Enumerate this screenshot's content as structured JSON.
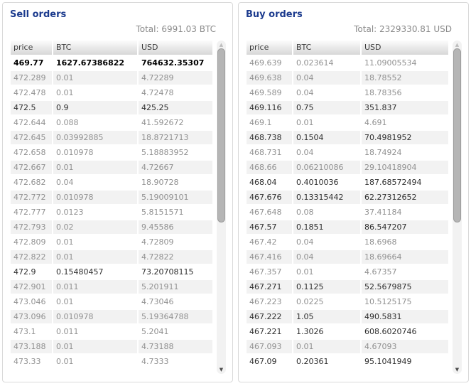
{
  "panels": [
    {
      "title": "Sell orders",
      "total": "Total: 6991.03 BTC",
      "columns": [
        "price",
        "BTC",
        "USD"
      ],
      "rows": [
        {
          "price": "469.77",
          "btc": "1627.67386822",
          "usd": "764632.35307",
          "style": "bold"
        },
        {
          "price": "472.289",
          "btc": "0.01",
          "usd": "4.72289",
          "style": "gray"
        },
        {
          "price": "472.478",
          "btc": "0.01",
          "usd": "4.72478",
          "style": "gray"
        },
        {
          "price": "472.5",
          "btc": "0.9",
          "usd": "425.25",
          "style": "dark"
        },
        {
          "price": "472.644",
          "btc": "0.088",
          "usd": "41.592672",
          "style": "gray"
        },
        {
          "price": "472.645",
          "btc": "0.03992885",
          "usd": "18.8721713",
          "style": "gray"
        },
        {
          "price": "472.658",
          "btc": "0.010978",
          "usd": "5.18883952",
          "style": "gray"
        },
        {
          "price": "472.667",
          "btc": "0.01",
          "usd": "4.72667",
          "style": "gray"
        },
        {
          "price": "472.682",
          "btc": "0.04",
          "usd": "18.90728",
          "style": "gray"
        },
        {
          "price": "472.772",
          "btc": "0.010978",
          "usd": "5.19009101",
          "style": "gray"
        },
        {
          "price": "472.777",
          "btc": "0.0123",
          "usd": "5.8151571",
          "style": "gray"
        },
        {
          "price": "472.793",
          "btc": "0.02",
          "usd": "9.45586",
          "style": "gray"
        },
        {
          "price": "472.809",
          "btc": "0.01",
          "usd": "4.72809",
          "style": "gray"
        },
        {
          "price": "472.822",
          "btc": "0.01",
          "usd": "4.72822",
          "style": "gray"
        },
        {
          "price": "472.9",
          "btc": "0.15480457",
          "usd": "73.20708115",
          "style": "dark"
        },
        {
          "price": "472.901",
          "btc": "0.011",
          "usd": "5.201911",
          "style": "gray"
        },
        {
          "price": "473.046",
          "btc": "0.01",
          "usd": "4.73046",
          "style": "gray"
        },
        {
          "price": "473.096",
          "btc": "0.010978",
          "usd": "5.19364788",
          "style": "gray"
        },
        {
          "price": "473.1",
          "btc": "0.011",
          "usd": "5.2041",
          "style": "gray"
        },
        {
          "price": "473.188",
          "btc": "0.01",
          "usd": "4.73188",
          "style": "gray"
        },
        {
          "price": "473.33",
          "btc": "0.01",
          "usd": "4.7333",
          "style": "gray"
        }
      ]
    },
    {
      "title": "Buy orders",
      "total": "Total: 2329330.81 USD",
      "columns": [
        "price",
        "BTC",
        "USD"
      ],
      "rows": [
        {
          "price": "469.639",
          "btc": "0.023614",
          "usd": "11.09005534",
          "style": "gray"
        },
        {
          "price": "469.638",
          "btc": "0.04",
          "usd": "18.78552",
          "style": "gray"
        },
        {
          "price": "469.589",
          "btc": "0.04",
          "usd": "18.78356",
          "style": "gray"
        },
        {
          "price": "469.116",
          "btc": "0.75",
          "usd": "351.837",
          "style": "dark"
        },
        {
          "price": "469.1",
          "btc": "0.01",
          "usd": "4.691",
          "style": "gray"
        },
        {
          "price": "468.738",
          "btc": "0.1504",
          "usd": "70.4981952",
          "style": "dark"
        },
        {
          "price": "468.731",
          "btc": "0.04",
          "usd": "18.74924",
          "style": "gray"
        },
        {
          "price": "468.66",
          "btc": "0.06210086",
          "usd": "29.10418904",
          "style": "gray"
        },
        {
          "price": "468.04",
          "btc": "0.4010036",
          "usd": "187.68572494",
          "style": "dark"
        },
        {
          "price": "467.676",
          "btc": "0.13315442",
          "usd": "62.27312652",
          "style": "dark"
        },
        {
          "price": "467.648",
          "btc": "0.08",
          "usd": "37.41184",
          "style": "gray"
        },
        {
          "price": "467.57",
          "btc": "0.1851",
          "usd": "86.547207",
          "style": "dark"
        },
        {
          "price": "467.42",
          "btc": "0.04",
          "usd": "18.6968",
          "style": "gray"
        },
        {
          "price": "467.416",
          "btc": "0.04",
          "usd": "18.69664",
          "style": "gray"
        },
        {
          "price": "467.357",
          "btc": "0.01",
          "usd": "4.67357",
          "style": "gray"
        },
        {
          "price": "467.271",
          "btc": "0.1125",
          "usd": "52.5679875",
          "style": "dark"
        },
        {
          "price": "467.223",
          "btc": "0.0225",
          "usd": "10.5125175",
          "style": "gray"
        },
        {
          "price": "467.222",
          "btc": "1.05",
          "usd": "490.5831",
          "style": "dark"
        },
        {
          "price": "467.221",
          "btc": "1.3026",
          "usd": "608.6020746",
          "style": "dark"
        },
        {
          "price": "467.093",
          "btc": "0.01",
          "usd": "4.67093",
          "style": "gray"
        },
        {
          "price": "467.09",
          "btc": "0.20361",
          "usd": "95.1041949",
          "style": "dark"
        }
      ]
    }
  ],
  "icons": {
    "scroll_up": "▲",
    "scroll_down": "▼"
  },
  "colors": {
    "title_navy": "#1c3b8e",
    "total_gray": "#8a8a8a",
    "row_alt_bg": "#f2f2f2",
    "gray_text": "#919191",
    "dark_text": "#2e2e2e",
    "panel_border": "#d9d9d9",
    "scroll_thumb": "#b5b5b5"
  }
}
